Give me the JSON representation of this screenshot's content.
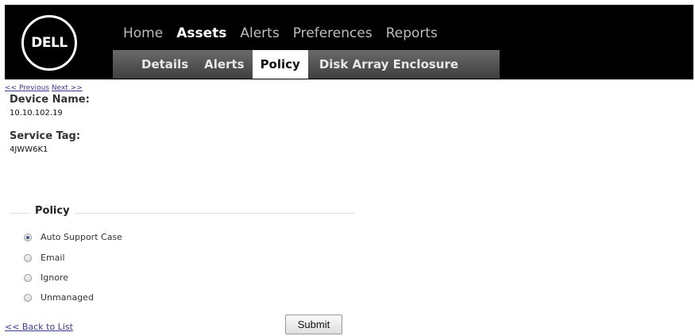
{
  "brand": {
    "logo_text": "DΕLL"
  },
  "topnav": {
    "items": [
      {
        "label": "Home"
      },
      {
        "label": "Assets"
      },
      {
        "label": "Alerts"
      },
      {
        "label": "Preferences"
      },
      {
        "label": "Reports"
      }
    ]
  },
  "subnav": {
    "items": [
      {
        "label": "Details"
      },
      {
        "label": "Alerts"
      },
      {
        "label": "Policy"
      },
      {
        "label": "Disk Array Enclosure"
      }
    ]
  },
  "pager": {
    "previous": "<< Previous",
    "next": "Next >>"
  },
  "device": {
    "name_label": "Device Name:",
    "name_value": "10.10.102.19",
    "tag_label": "Service Tag:",
    "tag_value": "4JWW6K1"
  },
  "policy": {
    "legend": "Policy",
    "options": [
      {
        "label": "Auto Support Case",
        "checked": true
      },
      {
        "label": "Email",
        "checked": false
      },
      {
        "label": "Ignore",
        "checked": false
      },
      {
        "label": "Unmanaged",
        "checked": false
      }
    ]
  },
  "footer": {
    "back_link": "<< Back to List",
    "submit_label": "Submit"
  }
}
